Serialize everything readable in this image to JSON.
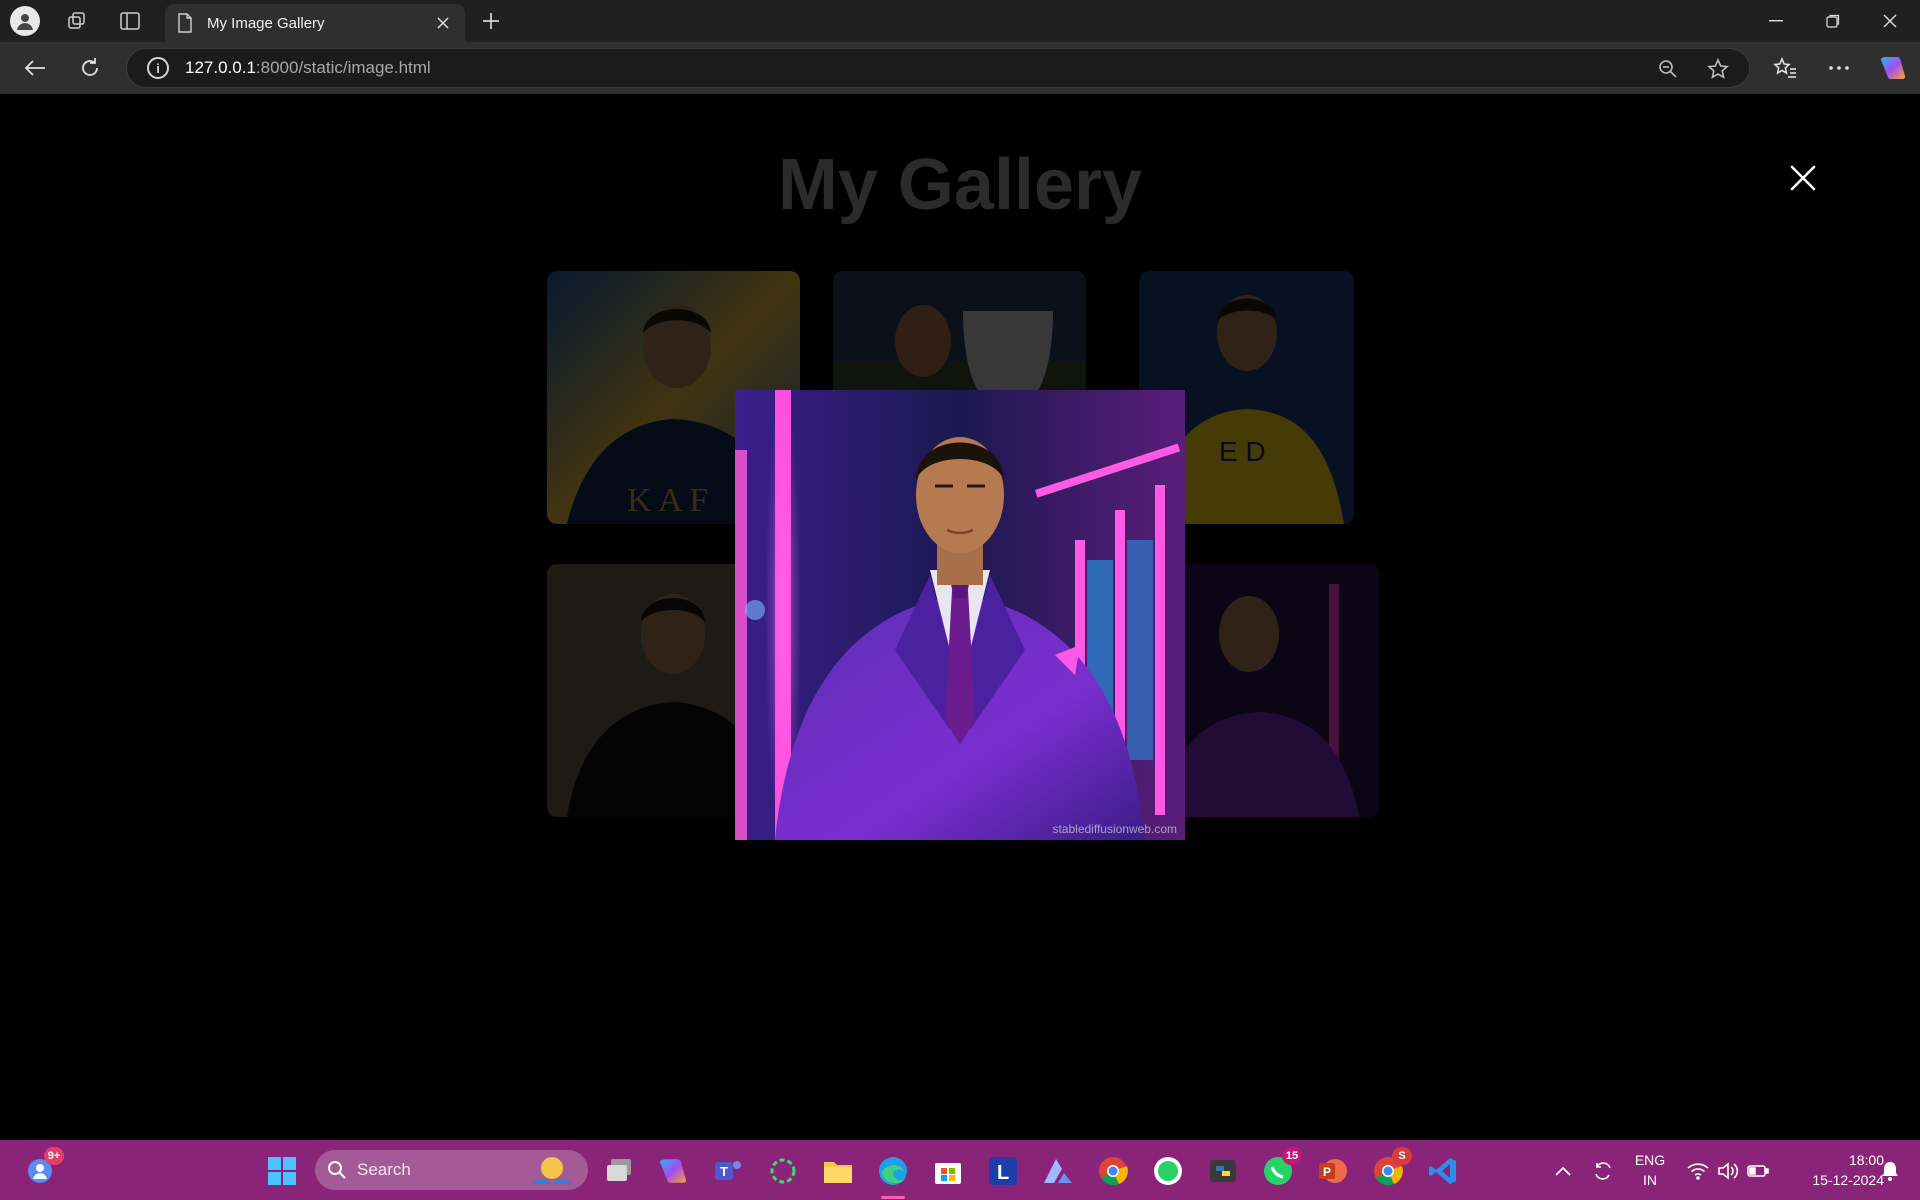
{
  "browser": {
    "tab_title": "My Image Gallery",
    "url_host": "127.0.0.1",
    "url_rest": ":8000/static/image.html"
  },
  "page": {
    "title": "My Gallery",
    "thumbnails": [
      {
        "name": "ronaldo-navy-jersey",
        "text": "K A F"
      },
      {
        "name": "ronaldo-trophy"
      },
      {
        "name": "ronaldo-yellow-jersey",
        "text": "E D"
      },
      {
        "name": "ronaldo-black-suit"
      },
      {
        "name": "ronaldo-purple-suit-small"
      }
    ],
    "modal": {
      "watermark": "stablediffusionweb.com"
    }
  },
  "taskbar": {
    "search_label": "Search",
    "chat_badge": "9+",
    "whatsapp_badge": "15",
    "chrome_badge": "S",
    "lang_line1": "ENG",
    "lang_line2": "IN",
    "time": "18:00",
    "date": "15-12-2024"
  },
  "colors": {
    "taskbar": "#8a2478",
    "tabbar": "#202020",
    "addressbar": "#2f2f2f",
    "page_background": "#000000"
  }
}
